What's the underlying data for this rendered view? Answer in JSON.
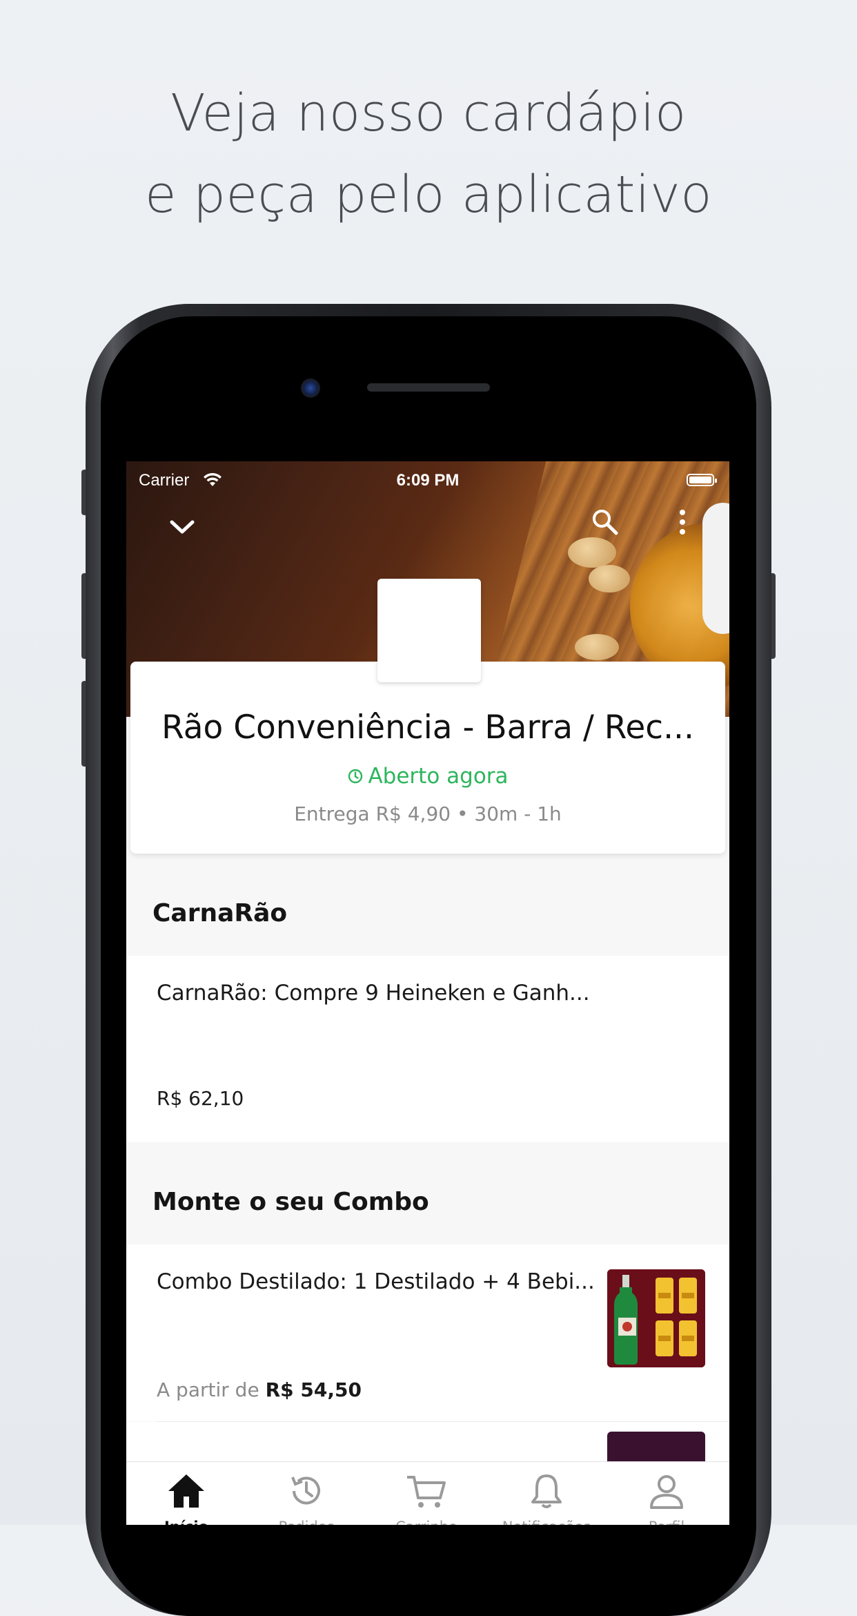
{
  "promo": {
    "line1": "Veja nosso cardápio",
    "line2": "e peça pelo aplicativo"
  },
  "status_bar": {
    "carrier": "Carrier",
    "time": "6:09 PM",
    "wifi_icon": "wifi-icon",
    "battery_icon": "battery-icon"
  },
  "top_nav": {
    "collapse_icon": "chevron-down-icon",
    "search_icon": "search-icon",
    "more_icon": "more-vertical-icon"
  },
  "store": {
    "name": "Rão Conveniência - Barra / Rec...",
    "open_status": "Aberto agora",
    "delivery_info": "Entrega R$ 4,90 • 30m - 1h"
  },
  "sections": [
    {
      "title": "CarnaRão",
      "items": [
        {
          "name": "CarnaRão: Compre 9 Heineken e Ganh...",
          "price_prefix": "",
          "price": "R$ 62,10",
          "has_image": false
        }
      ]
    },
    {
      "title": "Monte o seu Combo",
      "items": [
        {
          "name": "Combo Destilado: 1 Destilado + 4 Bebi...",
          "price_prefix": "A partir de",
          "price": "R$ 54,50",
          "has_image": true
        }
      ]
    }
  ],
  "tabs": [
    {
      "label": "Início",
      "icon": "home-icon",
      "active": true
    },
    {
      "label": "Pedidos",
      "icon": "history-icon",
      "active": false
    },
    {
      "label": "Carrinho",
      "icon": "cart-icon",
      "active": false
    },
    {
      "label": "Notificações",
      "icon": "bell-icon",
      "active": false
    },
    {
      "label": "Perfil",
      "icon": "user-icon",
      "active": false
    }
  ],
  "colors": {
    "open_green": "#2db55d",
    "muted_gray": "#8a8a8a",
    "combo_image_bg": "#6a0e1a"
  }
}
